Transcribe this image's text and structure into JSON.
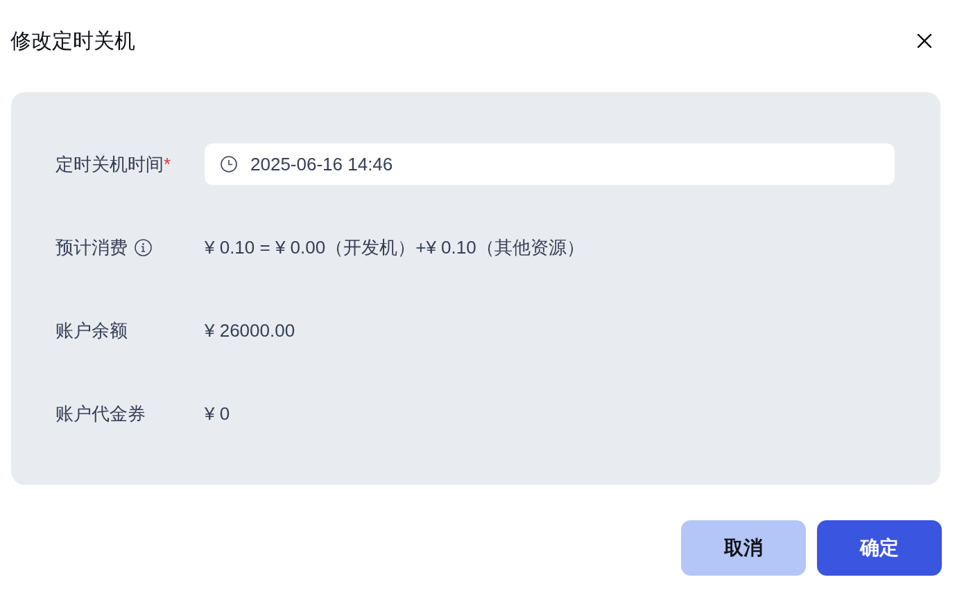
{
  "dialog": {
    "title": "修改定时关机"
  },
  "form": {
    "rows": [
      {
        "kind": "datetime",
        "label": "定时关机时间",
        "required_mark": "*",
        "value": "2025-06-16 14:46"
      },
      {
        "kind": "text",
        "label": "预计消费",
        "info": true,
        "value": "¥ 0.10 = ¥ 0.00（开发机）+¥ 0.10（其他资源）"
      },
      {
        "kind": "text",
        "label": "账户余额",
        "value": "¥ 26000.00"
      },
      {
        "kind": "text",
        "label": "账户代金券",
        "value": "¥ 0"
      }
    ]
  },
  "buttons": [
    {
      "kind": "secondary",
      "label": "取消"
    },
    {
      "kind": "primary",
      "label": "确定"
    }
  ]
}
